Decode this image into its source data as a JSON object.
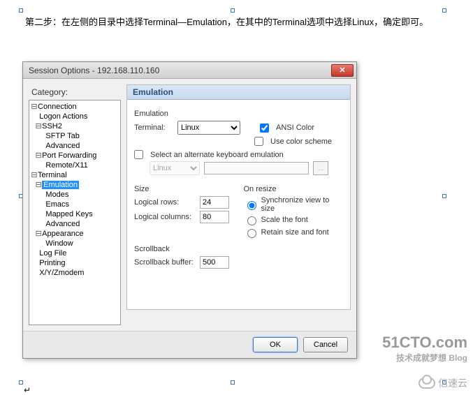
{
  "instruction": "第二步：在左侧的目录中选择Terminal—Emulation，在其中的Terminal选项中选择Linux，确定即可。",
  "dialog": {
    "title": "Session Options - 192.168.110.160",
    "category_label": "Category:",
    "tree": {
      "connection": "Connection",
      "logon_actions": "Logon Actions",
      "ssh2": "SSH2",
      "sftp_tab": "SFTP Tab",
      "advanced1": "Advanced",
      "port_forwarding": "Port Forwarding",
      "remote_x11": "Remote/X11",
      "terminal": "Terminal",
      "emulation": "Emulation",
      "modes": "Modes",
      "emacs": "Emacs",
      "mapped_keys": "Mapped Keys",
      "advanced2": "Advanced",
      "appearance": "Appearance",
      "window": "Window",
      "log_file": "Log File",
      "printing": "Printing",
      "xyzmodem": "X/Y/Zmodem"
    },
    "panel": {
      "header": "Emulation",
      "emu_group": "Emulation",
      "terminal_label": "Terminal:",
      "terminal_value": "Linux",
      "ansi_color": "ANSI Color",
      "ansi_color_checked": true,
      "use_color_scheme": "Use color scheme",
      "use_color_scheme_checked": false,
      "alt_kbd": "Select an alternate keyboard emulation",
      "alt_kbd_checked": false,
      "alt_kbd_value": "Linux",
      "browse": "...",
      "size_group": "Size",
      "logical_rows_label": "Logical rows:",
      "logical_rows": "24",
      "logical_cols_label": "Logical columns:",
      "logical_cols": "80",
      "onresize_group": "On resize",
      "sync": "Synchronize view to size",
      "scale": "Scale the font",
      "retain": "Retain size and font",
      "onresize_selected": "sync",
      "scrollback_group": "Scrollback",
      "scrollback_label": "Scrollback buffer:",
      "scrollback": "500"
    },
    "buttons": {
      "ok": "OK",
      "cancel": "Cancel"
    }
  },
  "watermarks": {
    "w1a": "51CTO.com",
    "w1b": "技术成就梦想   Blog",
    "w2": "亿速云"
  }
}
